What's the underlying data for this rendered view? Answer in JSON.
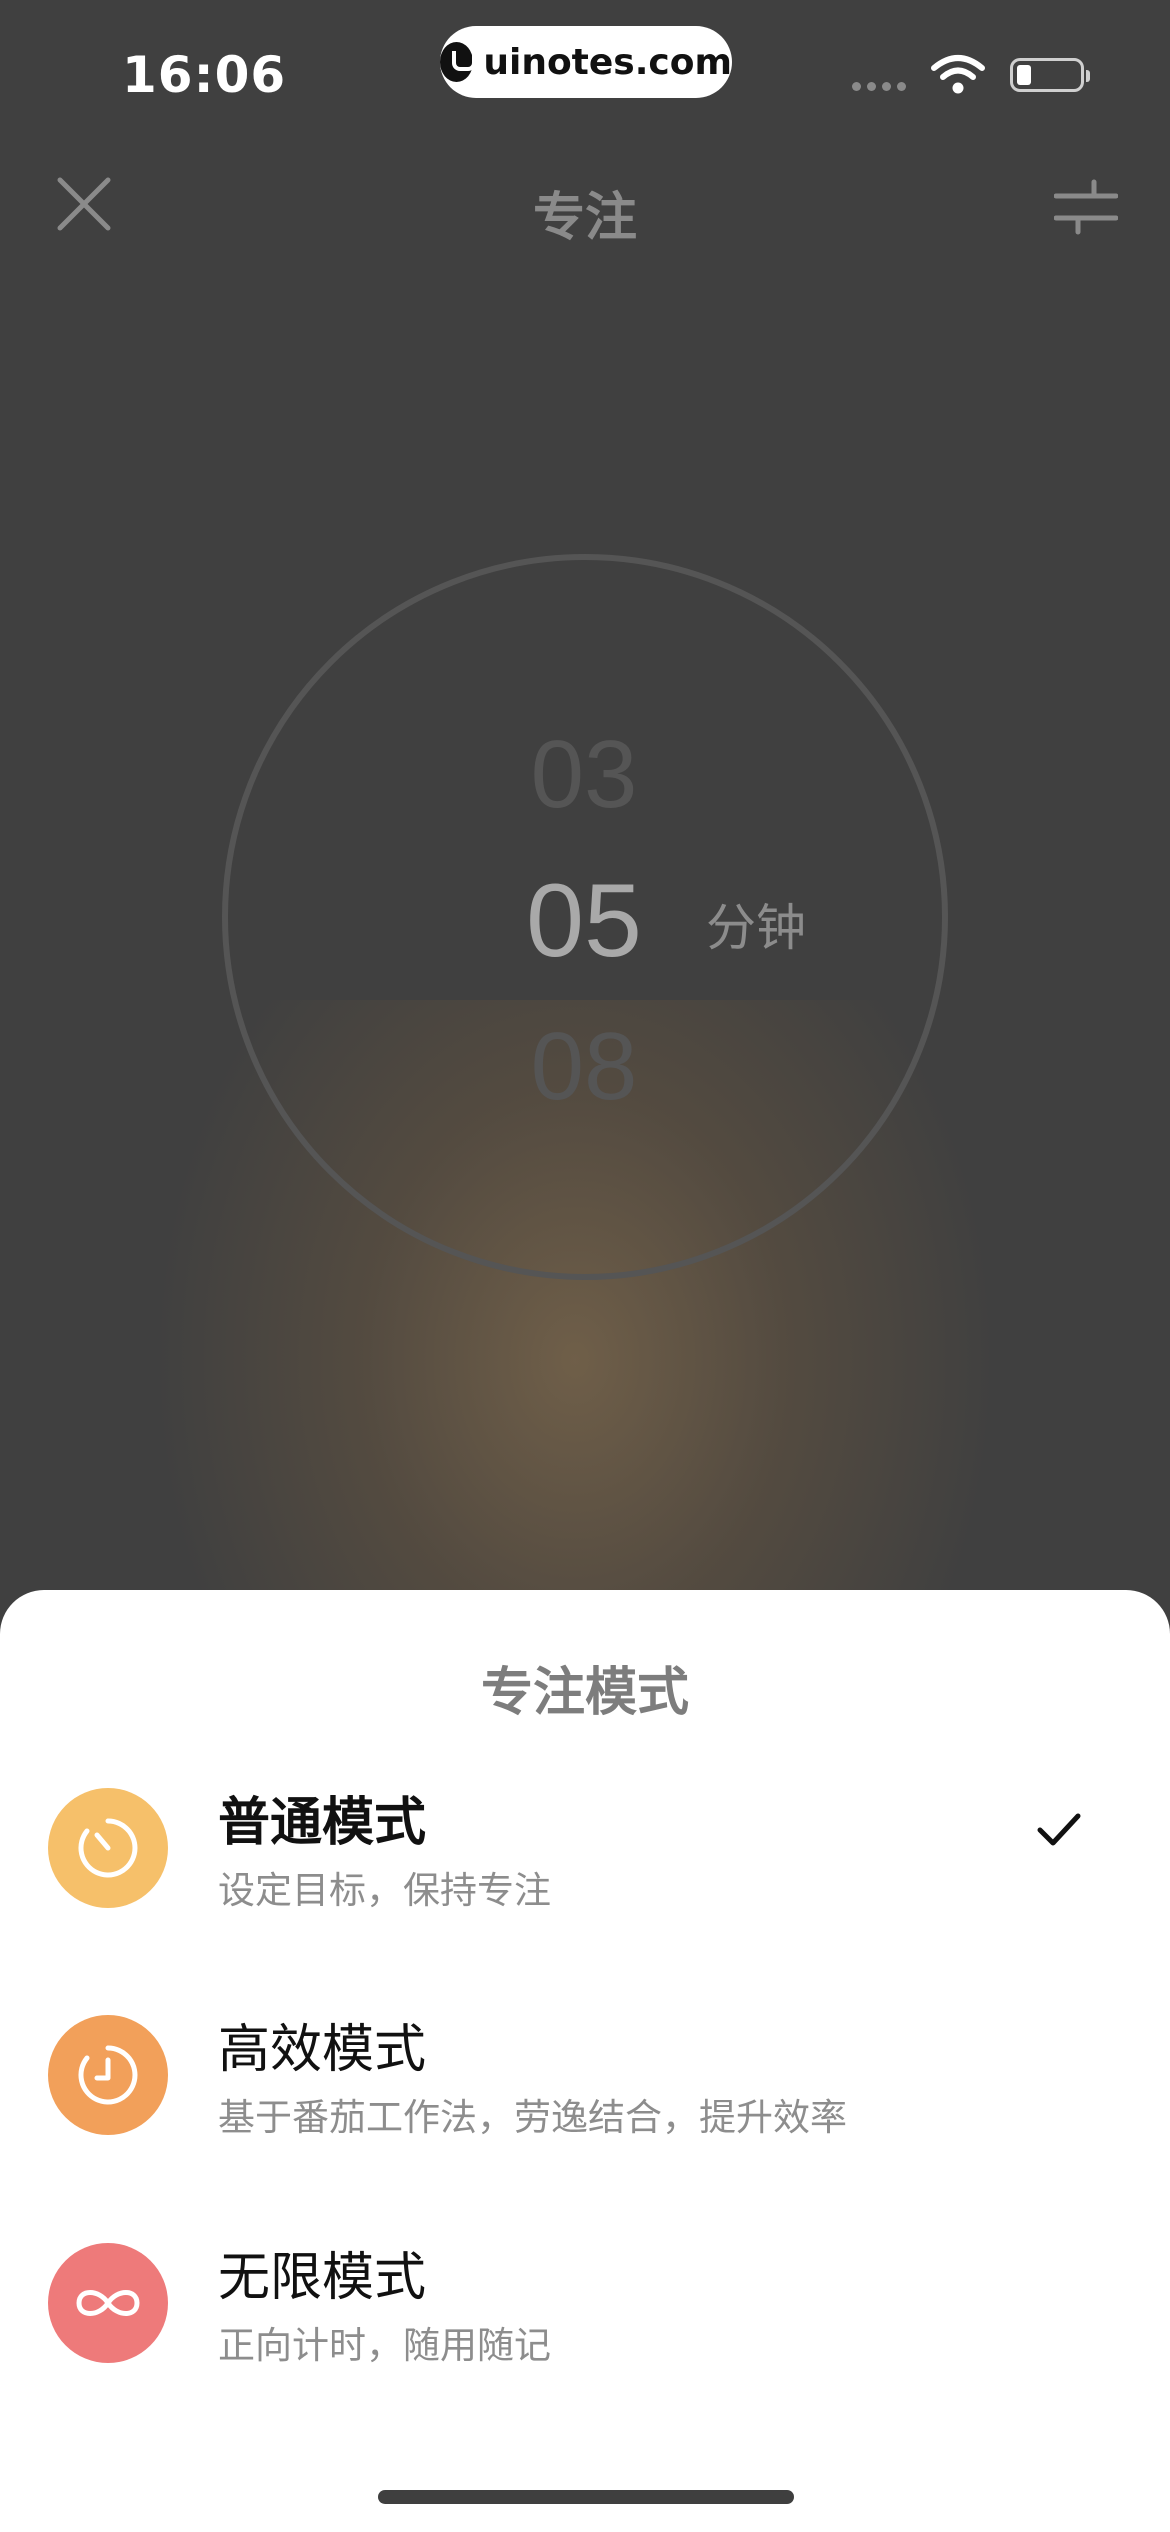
{
  "status_bar": {
    "time": "16:06",
    "url": "uinotes.com"
  },
  "nav": {
    "title": "专注",
    "close_icon": "close-icon",
    "settings_icon": "sliders-icon"
  },
  "timer": {
    "previous": "03",
    "current": "05",
    "next": "08",
    "unit": "分钟"
  },
  "sheet": {
    "title": "专注模式",
    "modes": [
      {
        "name": "普通模式",
        "desc": "设定目标，保持专注",
        "icon": "stopwatch-icon",
        "color": "#F6C06A",
        "selected": true
      },
      {
        "name": "高效模式",
        "desc": "基于番茄工作法，劳逸结合，提升效率",
        "icon": "clock-icon",
        "color": "#F2A05A",
        "selected": false
      },
      {
        "name": "无限模式",
        "desc": "正向计时，随用随记",
        "icon": "infinity-icon",
        "color": "#EE7A7A",
        "selected": false
      }
    ]
  },
  "colors": {
    "background": "#404040",
    "sheet": "#FFFFFF",
    "check": "#111111"
  }
}
